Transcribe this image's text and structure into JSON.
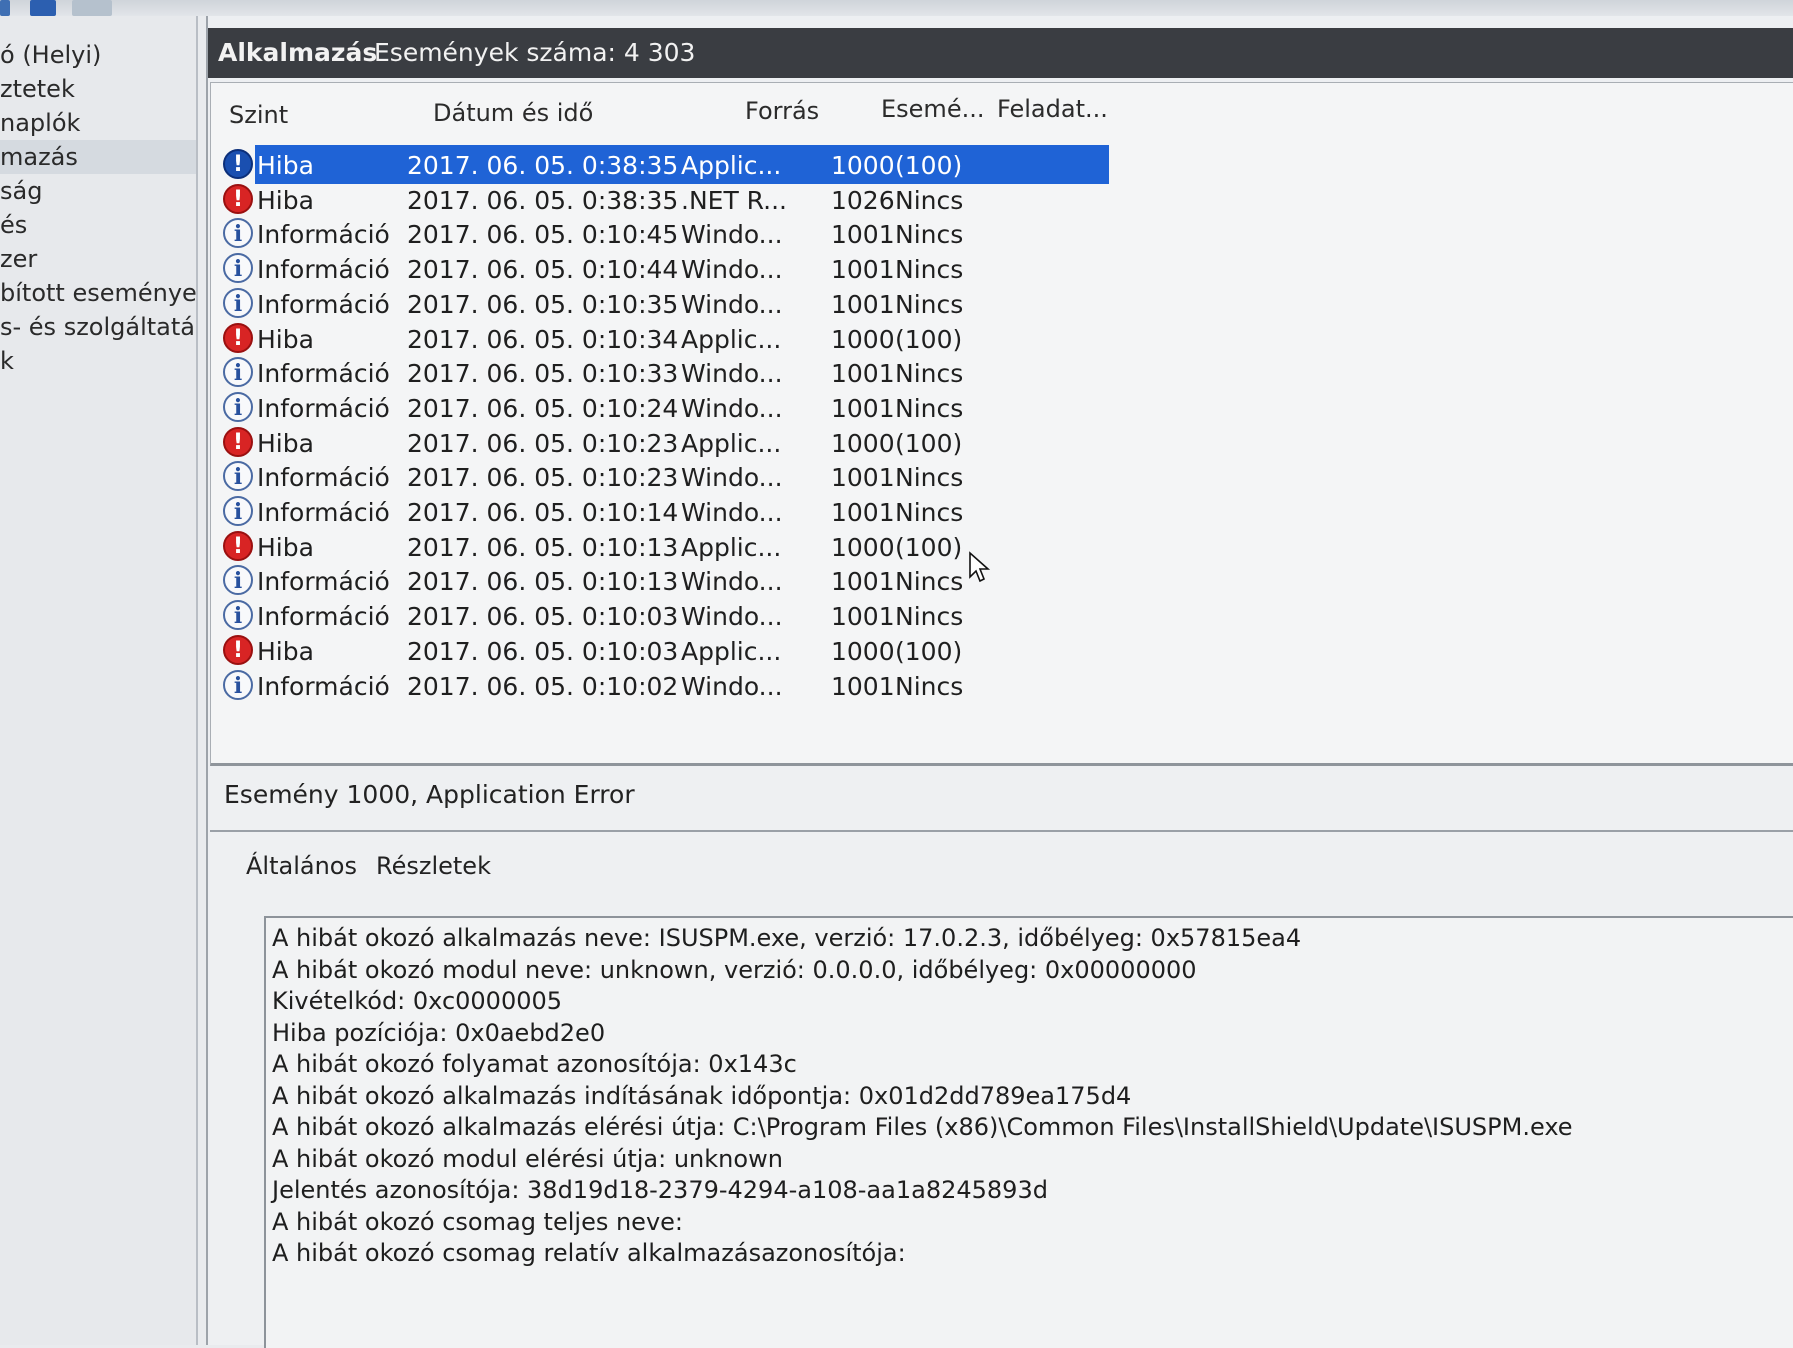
{
  "toolbar": {},
  "sidebar": {
    "items": [
      {
        "label": "ó (Helyi)"
      },
      {
        "label": "ztetek"
      },
      {
        "label": "naplók"
      },
      {
        "label": "mazás"
      },
      {
        "label": "ság"
      },
      {
        "label": "és"
      },
      {
        "label": "zer"
      },
      {
        "label": "bított események"
      },
      {
        "label": "s- és szolgáltatásn"
      },
      {
        "label": "k"
      }
    ]
  },
  "header": {
    "title": "Alkalmazás",
    "count": "Események száma: 4 303"
  },
  "grid": {
    "columns": {
      "level": "Szint",
      "datetime": "Dátum és idő",
      "source": "Forrás",
      "event_id": "Esemé...",
      "task": "Feladat..."
    },
    "rows": [
      {
        "level": "Hiba",
        "datetime": "2017. 06. 05. 0:38:35",
        "source": "Applic...",
        "event_id": "1000",
        "task": "(100)"
      },
      {
        "level": "Hiba",
        "datetime": "2017. 06. 05. 0:38:35",
        "source": ".NET R...",
        "event_id": "1026",
        "task": "Nincs"
      },
      {
        "level": "Információ",
        "datetime": "2017. 06. 05. 0:10:45",
        "source": "Windo...",
        "event_id": "1001",
        "task": "Nincs"
      },
      {
        "level": "Információ",
        "datetime": "2017. 06. 05. 0:10:44",
        "source": "Windo...",
        "event_id": "1001",
        "task": "Nincs"
      },
      {
        "level": "Információ",
        "datetime": "2017. 06. 05. 0:10:35",
        "source": "Windo...",
        "event_id": "1001",
        "task": "Nincs"
      },
      {
        "level": "Hiba",
        "datetime": "2017. 06. 05. 0:10:34",
        "source": "Applic...",
        "event_id": "1000",
        "task": "(100)"
      },
      {
        "level": "Információ",
        "datetime": "2017. 06. 05. 0:10:33",
        "source": "Windo...",
        "event_id": "1001",
        "task": "Nincs"
      },
      {
        "level": "Információ",
        "datetime": "2017. 06. 05. 0:10:24",
        "source": "Windo...",
        "event_id": "1001",
        "task": "Nincs"
      },
      {
        "level": "Hiba",
        "datetime": "2017. 06. 05. 0:10:23",
        "source": "Applic...",
        "event_id": "1000",
        "task": "(100)"
      },
      {
        "level": "Információ",
        "datetime": "2017. 06. 05. 0:10:23",
        "source": "Windo...",
        "event_id": "1001",
        "task": "Nincs"
      },
      {
        "level": "Információ",
        "datetime": "2017. 06. 05. 0:10:14",
        "source": "Windo...",
        "event_id": "1001",
        "task": "Nincs"
      },
      {
        "level": "Hiba",
        "datetime": "2017. 06. 05. 0:10:13",
        "source": "Applic...",
        "event_id": "1000",
        "task": "(100)"
      },
      {
        "level": "Információ",
        "datetime": "2017. 06. 05. 0:10:13",
        "source": "Windo...",
        "event_id": "1001",
        "task": "Nincs"
      },
      {
        "level": "Információ",
        "datetime": "2017. 06. 05. 0:10:03",
        "source": "Windo...",
        "event_id": "1001",
        "task": "Nincs"
      },
      {
        "level": "Hiba",
        "datetime": "2017. 06. 05. 0:10:03",
        "source": "Applic...",
        "event_id": "1000",
        "task": "(100)"
      },
      {
        "level": "Információ",
        "datetime": "2017. 06. 05. 0:10:02",
        "source": "Windo...",
        "event_id": "1001",
        "task": "Nincs"
      }
    ]
  },
  "detail": {
    "title": "Esemény 1000, Application Error",
    "tabs": [
      "Általános",
      "Részletek"
    ],
    "lines": [
      "A hibát okozó alkalmazás neve: ISUSPM.exe, verzió: 17.0.2.3, időbélyeg: 0x57815ea4",
      "A hibát okozó modul neve: unknown, verzió: 0.0.0.0, időbélyeg: 0x00000000",
      "Kivételkód: 0xc0000005",
      "Hiba pozíciója: 0x0aebd2e0",
      "A hibát okozó folyamat azonosítója: 0x143c",
      "A hibát okozó alkalmazás indításának időpontja: 0x01d2dd789ea175d4",
      "A hibát okozó alkalmazás elérési útja: C:\\Program Files (x86)\\Common Files\\InstallShield\\Update\\ISUSPM.exe",
      "A hibát okozó modul elérési útja: unknown",
      "Jelentés azonosítója: 38d19d18-2379-4294-a108-aa1a8245893d",
      "A hibát okozó csomag teljes neve:",
      "A hibát okozó csomag relatív alkalmazásazonosítója:"
    ]
  },
  "icons": {
    "error": "error-icon",
    "information": "information-icon",
    "selected_level": "Hiba"
  },
  "colors": {
    "selection": "#1f63d6",
    "header_bar": "#3a3d42",
    "error": "#d82424",
    "info": "#28519e"
  }
}
